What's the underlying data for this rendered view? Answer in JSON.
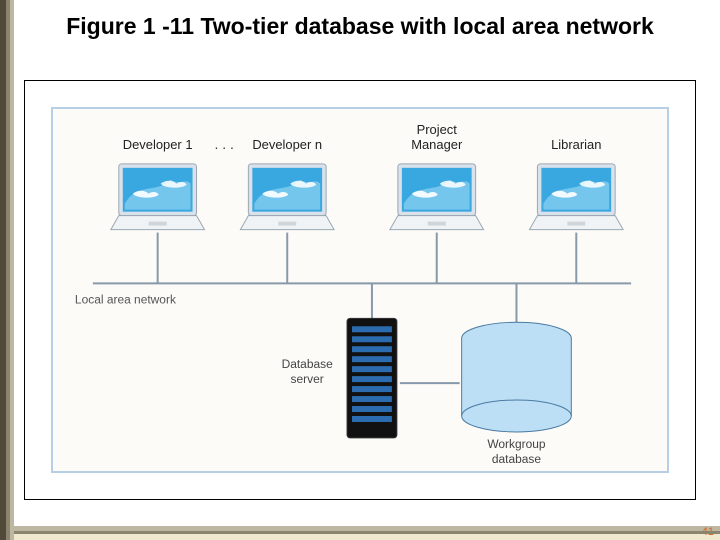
{
  "slide": {
    "title": "Figure 1 -11 Two-tier database with local area network",
    "page_number": "41"
  },
  "roles": {
    "dev1": "Developer 1",
    "dots": ". . .",
    "devn": "Developer n",
    "project_manager_line1": "Project",
    "project_manager_line2": "Manager",
    "librarian": "Librarian"
  },
  "lan_label": "Local area network",
  "nodes": {
    "db_server_line1": "Database",
    "db_server_line2": "server",
    "wg_db_line1": "Workgroup",
    "wg_db_line2": "database"
  }
}
